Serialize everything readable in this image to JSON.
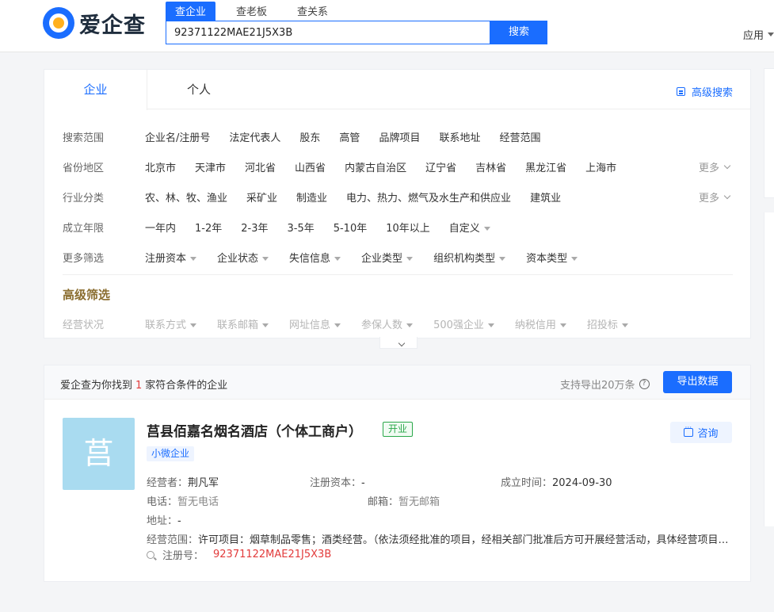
{
  "header": {
    "logo_text": "爱企查",
    "search_tabs": [
      "查企业",
      "查老板",
      "查关系"
    ],
    "search_value": "92371122MAE21J5X3B",
    "search_button": "搜索",
    "app_menu": "应用"
  },
  "filters": {
    "tabs": [
      "企业",
      "个人"
    ],
    "advanced_search": "高级搜索",
    "rows": {
      "scope": {
        "label": "搜索范围",
        "options": [
          "企业名/注册号",
          "法定代表人",
          "股东",
          "高管",
          "品牌项目",
          "联系地址",
          "经营范围"
        ]
      },
      "region": {
        "label": "省份地区",
        "options": [
          "北京市",
          "天津市",
          "河北省",
          "山西省",
          "内蒙古自治区",
          "辽宁省",
          "吉林省",
          "黑龙江省",
          "上海市"
        ],
        "more": "更多"
      },
      "industry": {
        "label": "行业分类",
        "options": [
          "农、林、牧、渔业",
          "采矿业",
          "制造业",
          "电力、热力、燃气及水生产和供应业",
          "建筑业"
        ],
        "more": "更多"
      },
      "years": {
        "label": "成立年限",
        "options": [
          "一年内",
          "1-2年",
          "2-3年",
          "3-5年",
          "5-10年",
          "10年以上",
          "自定义"
        ]
      },
      "more_filters": {
        "label": "更多筛选",
        "options": [
          "注册资本",
          "企业状态",
          "失信信息",
          "企业类型",
          "组织机构类型",
          "资本类型"
        ]
      }
    },
    "advanced_title": "高级筛选",
    "advanced_row": {
      "label": "经营状况",
      "options": [
        "联系方式",
        "联系邮箱",
        "网址信息",
        "参保人数",
        "500强企业",
        "纳税信用",
        "招投标"
      ]
    }
  },
  "results": {
    "count_prefix": "爱企查为你找到",
    "count": "1",
    "count_suffix": "家符合条件的企业",
    "export_note": "支持导出20万条",
    "export_button": "导出数据",
    "company": {
      "logo_char": "莒",
      "name": "莒县佰嘉名烟名酒店（个体工商户）",
      "status": "开业",
      "size_tag": "小微企业",
      "consult": "咨询",
      "operator_label": "经营者：",
      "operator": "荆凡军",
      "capital_label": "注册资本：",
      "capital": "-",
      "founded_label": "成立时间：",
      "founded": "2024-09-30",
      "phone_label": "电话：",
      "phone": "暂无电话",
      "email_label": "邮箱：",
      "email": "暂无邮箱",
      "address_label": "地址：",
      "address": "-",
      "scope_label": "经营范围：",
      "scope": "许可项目：烟草制品零售；酒类经营。（依法须经批准的项目，经相关部门批准后方可开展经营活动，具体经营项目以相关部门批准文件或许可证件为准）",
      "reg_label": "注册号：",
      "reg_no": "92371122MAE21J5X3B"
    }
  },
  "colors": {
    "brand": "#1a6dff",
    "highlight": "#e23b3b",
    "open_status": "#2aa84a",
    "advanced_title": "#8a6d2f"
  }
}
